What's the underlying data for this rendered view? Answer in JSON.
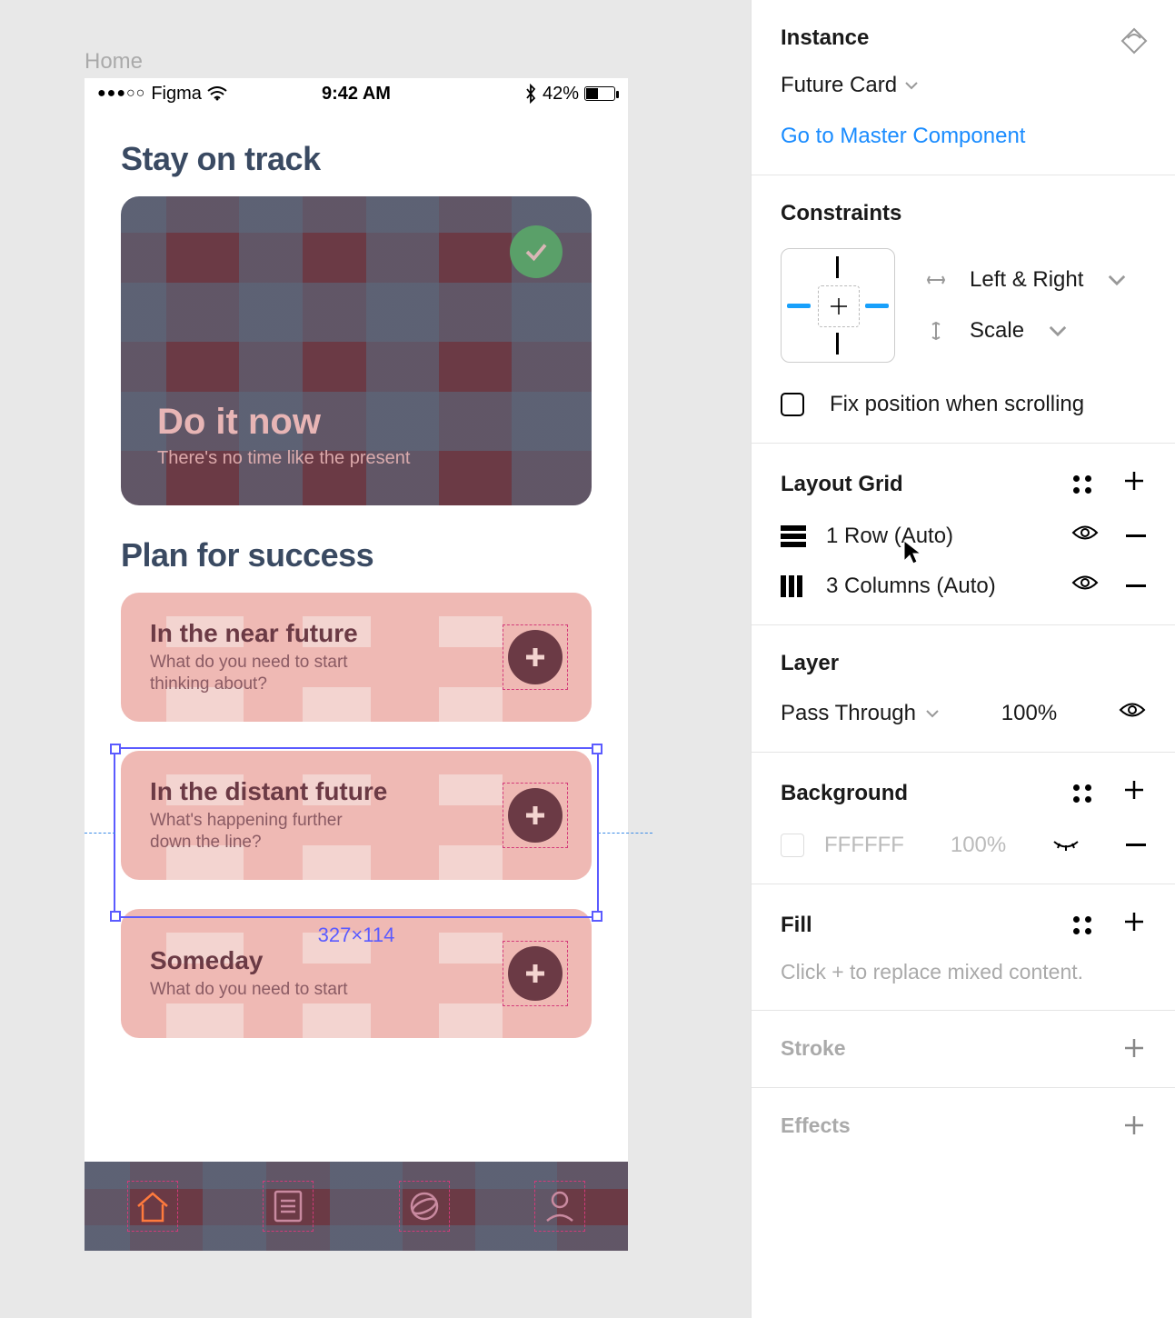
{
  "frame_label": "Home",
  "status_bar": {
    "carrier": "Figma",
    "time": "9:42 AM",
    "battery_pct": "42%"
  },
  "now_section": {
    "title": "Stay on track",
    "card": {
      "headline": "Do it now",
      "subline": "There's no time like the present"
    }
  },
  "future_section": {
    "title": "Plan for success",
    "cards": [
      {
        "headline": "In the near future",
        "subline": "What do you need to start thinking about?"
      },
      {
        "headline": "In the distant future",
        "subline": "What's happening further down the line?"
      },
      {
        "headline": "Someday",
        "subline": "What do you need to start"
      }
    ]
  },
  "selection_label": "327×114",
  "inspector": {
    "instance_label": "Instance",
    "instance_name": "Future Card",
    "goto_master": "Go to Master Component",
    "constraints_label": "Constraints",
    "h_constraint": "Left & Right",
    "v_constraint": "Scale",
    "fix_position": "Fix position when scrolling",
    "layout_grid_label": "Layout Grid",
    "grid_rows": "1 Row (Auto)",
    "grid_cols": "3 Columns (Auto)",
    "layer_label": "Layer",
    "blend_mode": "Pass Through",
    "opacity": "100%",
    "background_label": "Background",
    "bg_hex": "FFFFFF",
    "bg_opacity": "100%",
    "fill_label": "Fill",
    "fill_hint": "Click + to replace mixed content.",
    "stroke_label": "Stroke",
    "effects_label": "Effects"
  }
}
